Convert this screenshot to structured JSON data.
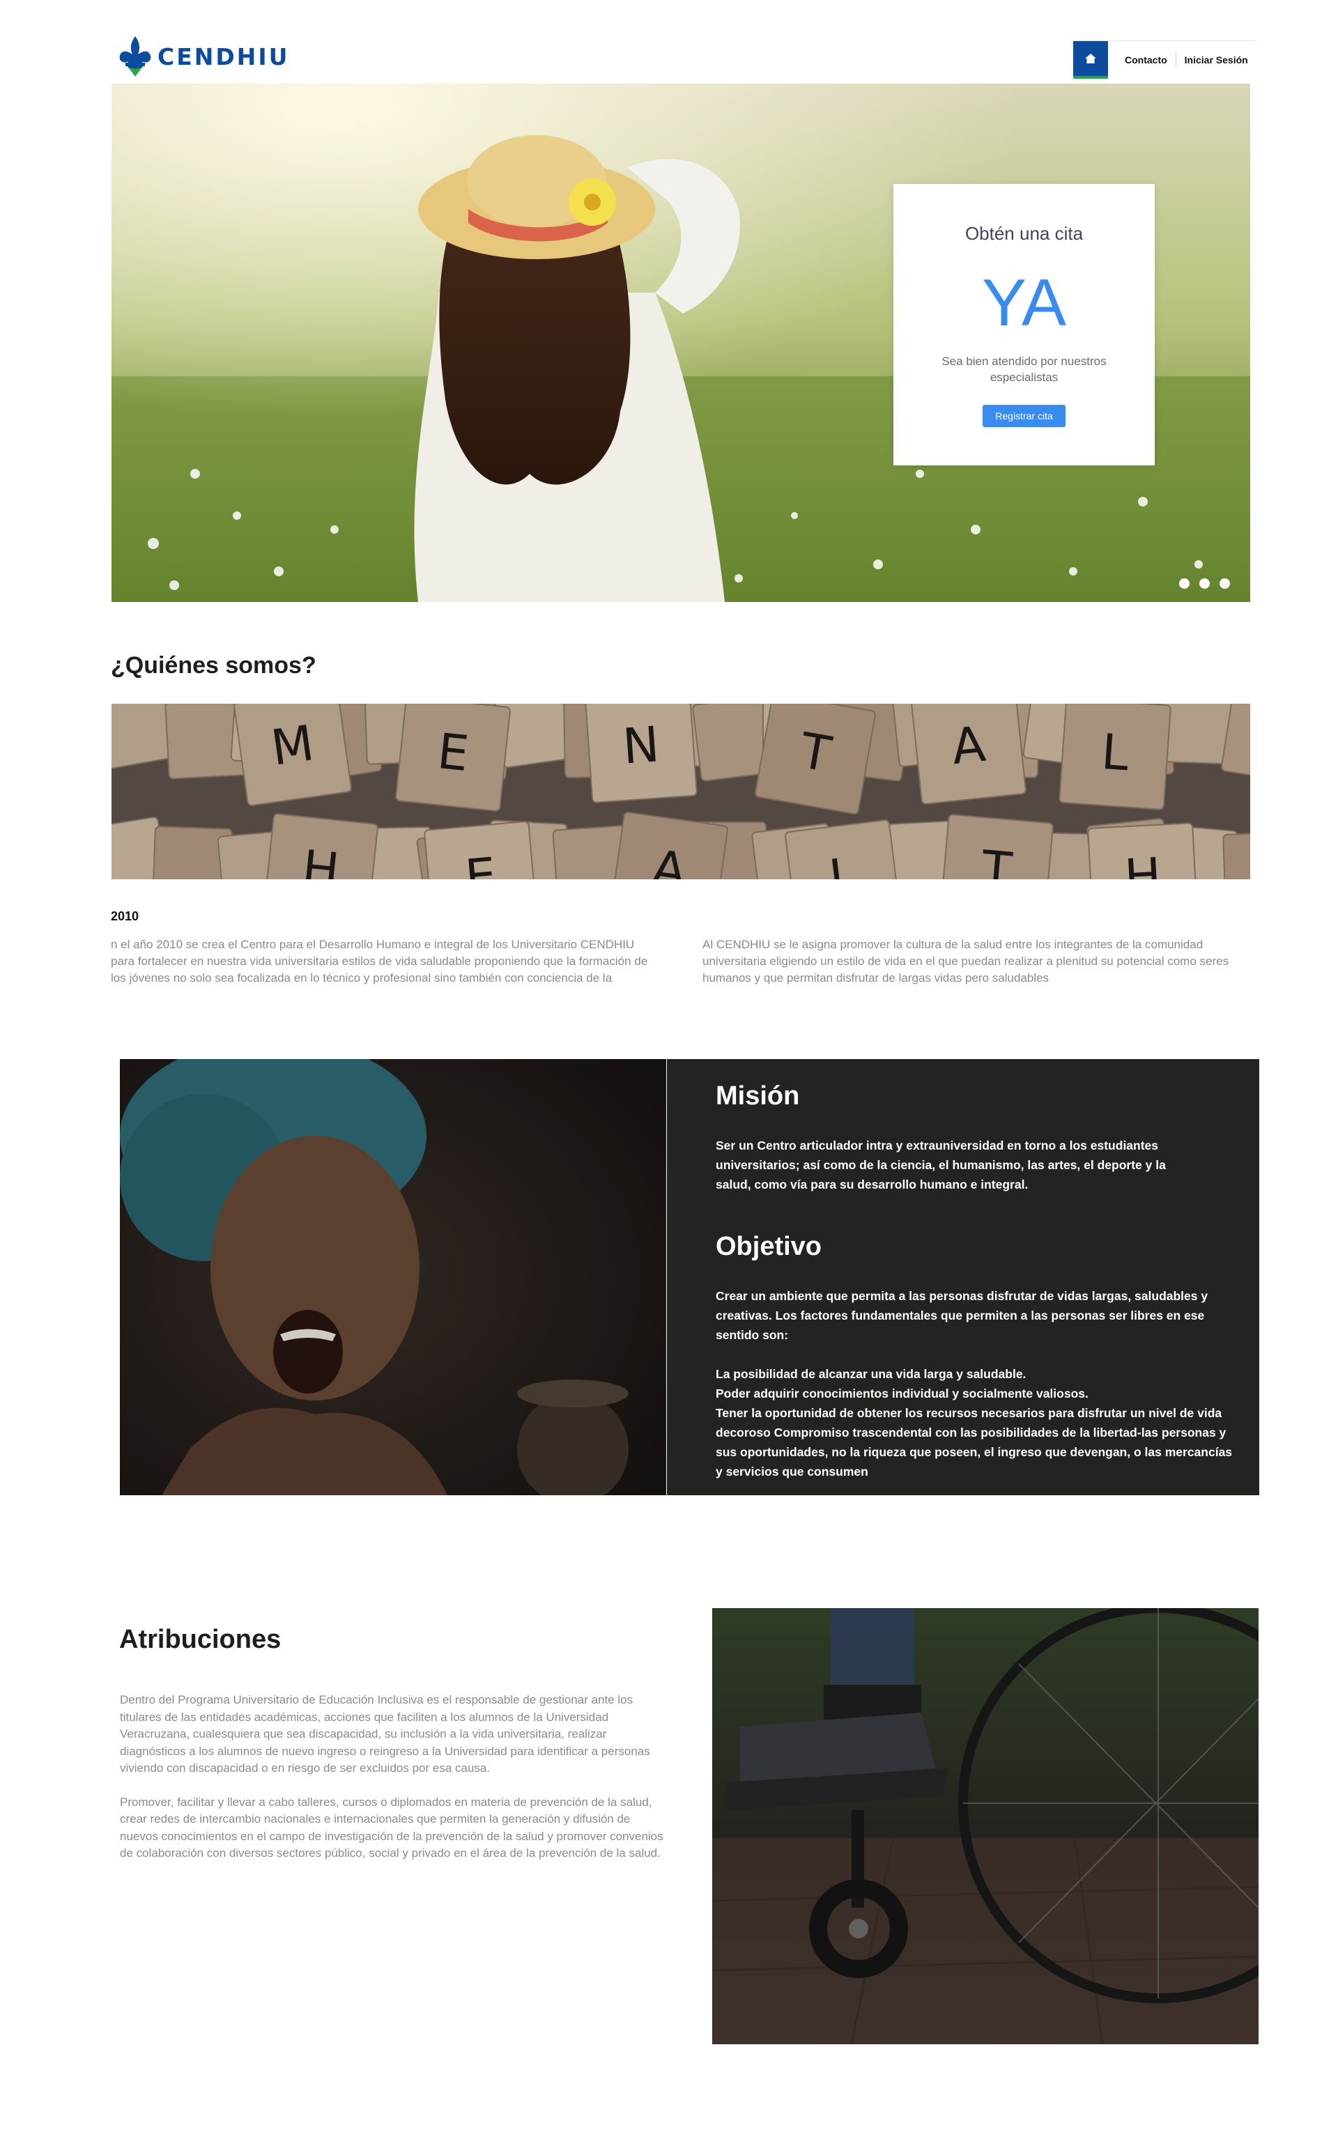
{
  "header": {
    "brand": "CENDHIU",
    "nav": {
      "contact": "Contacto",
      "login": "Iniciar Sesión"
    }
  },
  "hero": {
    "card_title": "Obtén una cita",
    "card_highlight": "YA",
    "card_subtitle": "Sea bien atendido por nuestros especialistas",
    "card_button": "Registrar cita",
    "slides": 3
  },
  "about": {
    "heading": "¿Quiénes somos?",
    "banner_letters_top": [
      "M",
      "E",
      "N",
      "T",
      "A",
      "L"
    ],
    "banner_letters_bottom": [
      "H",
      "E",
      "A",
      "L",
      "T",
      "H"
    ],
    "year": "2010",
    "left_text": "n el año 2010 se crea el Centro para el Desarrollo Humano e integral de los Universitario CENDHIU para fortalecer en nuestra vida universitaria estilos de vida saludable proponiendo que la formación de los jóvenes no solo sea focalizada en lo técnico y profesional sino también con conciencia de la",
    "right_text": "Al CENDHIU se le asigna promover la cultura de la salud entre los integrantes de la comunidad universitaria eligiendo un estilo de vida en el que puedan realizar a plenitud su potencial como seres humanos y que permitan disfrutar de largas vidas pero saludables"
  },
  "mission": {
    "heading": "Misión",
    "text": "Ser un Centro articulador intra y extrauniversidad en torno a los estudiantes universitarios; así como de la ciencia, el humanismo, las artes,  el deporte y la salud, como vía para su  desarrollo humano e integral."
  },
  "objective": {
    "heading": "Objetivo",
    "intro": "Crear un ambiente que permita a las personas disfrutar de vidas largas, saludables y creativas. Los factores fundamentales que permiten a las personas ser libres en ese sentido son:",
    "items": [
      "La posibilidad de alcanzar una vida larga y saludable.",
      "Poder adquirir conocimientos individual y socialmente valiosos.",
      "Tener la oportunidad de obtener los recursos necesarios para disfrutar un nivel de vida decoroso Compromiso trascendental con las posibilidades de la libertad-las personas y sus oportunidades, no la riqueza que poseen, el ingreso que devengan, o las mercancías y servicios que consumen"
    ]
  },
  "attributions": {
    "heading": "Atribuciones",
    "p1": "Dentro del Programa Universitario de Educación Inclusiva es el responsable de gestionar ante los titulares de las entidades académicas, acciones que faciliten a los alumnos de la Universidad Veracruzana, cualesquiera que sea discapacidad, su inclusión a la vida universitaria, realizar diagnósticos a los alumnos de nuevo ingreso o reingreso a la Universidad para identificar a personas viviendo con discapacidad o en riesgo de ser excluidos por esa causa.",
    "p2": "Promover, facilitar y llevar a cabo talleres, cursos o diplomados en materia de prevención de la salud, crear redes de intercambio nacionales e internacionales que permiten la generación y difusión de nuevos conocimientos en el campo de investigación de la prevención de la salud y promover convenios de colaboración con diversos sectores público, social y privado en el área de la prevención de la salud."
  },
  "colors": {
    "brand": "#0d4c9c",
    "accent_green": "#2aa34a",
    "button_blue": "#3a8bf0",
    "dark_panel": "#242320"
  }
}
